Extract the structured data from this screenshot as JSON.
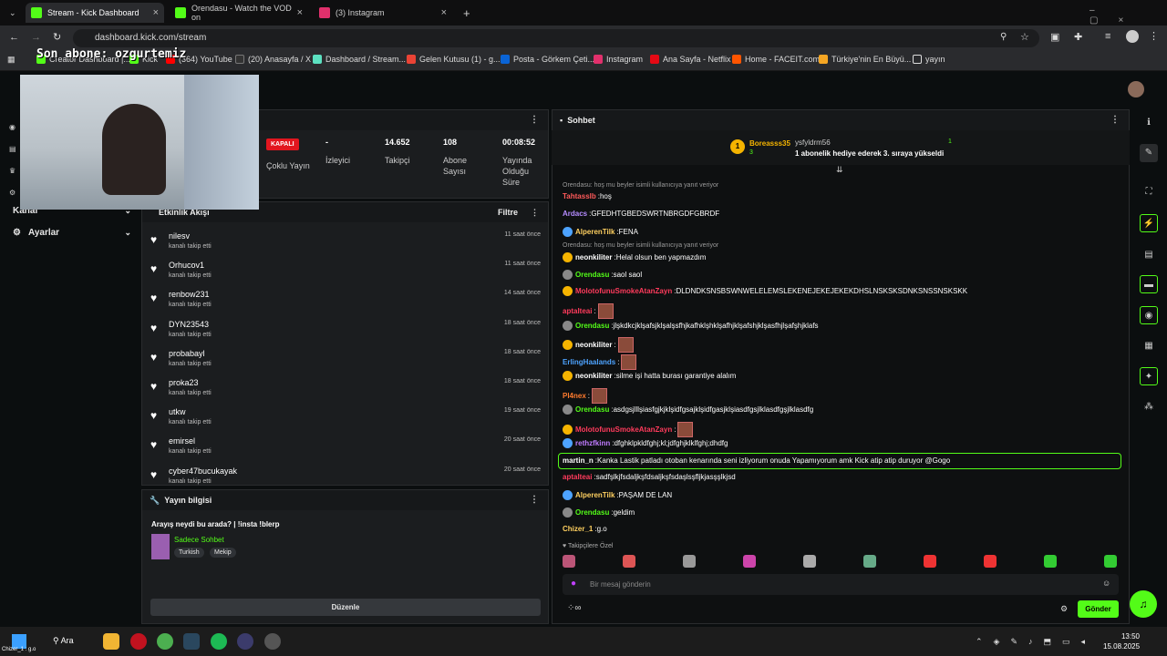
{
  "browser": {
    "tabs": [
      {
        "title": "Stream - Kick Dashboard",
        "active": true
      },
      {
        "title": "Orendasu - Watch the VOD on",
        "active": false
      },
      {
        "title": "(3) Instagram",
        "active": false
      }
    ],
    "url": "dashboard.kick.com/stream",
    "bookmarks": [
      "Creator Dashboard |...",
      "Kick",
      "(364) YouTube",
      "(20) Anasayfa / X",
      "Dashboard / Stream...",
      "Gelen Kutusu (1) - g...",
      "Posta - Görkem Çeti...",
      "Instagram",
      "Ana Sayfa - Netflix",
      "Home - FACEIT.com",
      "Türkiye'nin En Büyü...",
      "yayın"
    ]
  },
  "overlay": {
    "text": "Son abone: ozgurtemiz"
  },
  "sidebar": {
    "items": [
      {
        "label": "Kanal"
      },
      {
        "label": "Ayarlar"
      }
    ]
  },
  "stats": {
    "status": "KAPALI",
    "multi": "Çoklu Yayın",
    "viewers": {
      "value": "-",
      "label": "İzleyici"
    },
    "followers": {
      "value": "14.652",
      "label": "Takipçi"
    },
    "subs": {
      "value": "108",
      "label": "Abone Sayısı"
    },
    "uptime": {
      "value": "00:08:52",
      "label": "Yayında Olduğu Süre"
    }
  },
  "activity": {
    "title": "Etkinlik Akışı",
    "filter": "Filtre",
    "items": [
      {
        "name": "nilesv",
        "sub": "kanalı takip etti",
        "time": "11 saat önce"
      },
      {
        "name": "Orhucov1",
        "sub": "kanalı takip etti",
        "time": "11 saat önce"
      },
      {
        "name": "renbow231",
        "sub": "kanalı takip etti",
        "time": "14 saat önce"
      },
      {
        "name": "DYN23543",
        "sub": "kanalı takip etti",
        "time": "18 saat önce"
      },
      {
        "name": "probabayl",
        "sub": "kanalı takip etti",
        "time": "18 saat önce"
      },
      {
        "name": "proka23",
        "sub": "kanalı takip etti",
        "time": "18 saat önce"
      },
      {
        "name": "utkw",
        "sub": "kanalı takip etti",
        "time": "19 saat önce"
      },
      {
        "name": "emirsel",
        "sub": "kanalı takip etti",
        "time": "20 saat önce"
      },
      {
        "name": "cyber47bucukayak",
        "sub": "kanalı takip etti",
        "time": "20 saat önce"
      }
    ]
  },
  "streaminfo": {
    "title": "Yayın bilgisi",
    "stream_title": "Arayış neydi bu arada? | !insta !blerp",
    "category": "Sadece Sohbet",
    "tags": [
      "Turkish",
      "Mekip"
    ],
    "edit": "Düzenle"
  },
  "chat": {
    "title": "Sohbet",
    "pinned": {
      "user1": "Boreasss35",
      "count1": "3",
      "user2": "ysfyldrm56",
      "count2": "1",
      "msg": "1 abonelik hediye ederek 3. sıraya yükseldi"
    },
    "reply1": "Orendasu: hoş mu beyler isimli kullanıcıya yanıt veriyor",
    "reply2": "Orendasu: hoş mu beyler isimli kullanıcıya yanıt veriyor",
    "lines": [
      {
        "user": "Tahtasslb",
        "text": "hoş",
        "color": "#ff5a5a"
      },
      {
        "user": "Ardacs",
        "text": "GFEDHTGBEDSWRTNBRGDFGBRDF",
        "color": "#b58cff"
      },
      {
        "user": "AlperenTilk",
        "text": "FENA",
        "color": "#ffd060"
      },
      {
        "user": "neonkiliter",
        "text": "Helal olsun ben yapmazdım",
        "color": "#ffffff"
      },
      {
        "user": "Orendasu",
        "text": "saol saol",
        "color": "#53fc18"
      },
      {
        "user": "MolotofunuSmokeAtanZayn",
        "text": "DLDNDKSNSBSWNWELELEMSLEKENEJEKEJEKEKDHSLNSKSKSDNKSNSSNSKSKK",
        "color": "#ff3b5c"
      },
      {
        "user": "aptalteai",
        "text": "",
        "color": "#ff3b5c"
      },
      {
        "user": "Orendasu",
        "text": "jlşkdkcjklşafsjklşalşsfhjkafhklşhklşafhjklşafshjklşasfhjlşafşhjklafs",
        "color": "#53fc18"
      },
      {
        "user": "neonkiliter",
        "text": "",
        "color": "#ffffff"
      },
      {
        "user": "ErlingHaalands",
        "text": "",
        "color": "#4da3ff"
      },
      {
        "user": "neonkiliter",
        "text": "silme işi hatta burası garantiye alalım",
        "color": "#ffffff"
      },
      {
        "user": "Pl4nex",
        "text": "",
        "color": "#ff7b2e"
      },
      {
        "user": "Orendasu",
        "text": "asdgsjlllşiasfgjkjklşidfgsajklşidfgasjklşiasdfgsjlklasdfgşjlklasdfg",
        "color": "#53fc18"
      },
      {
        "user": "MolotofunuSmokeAtanZayn",
        "text": "",
        "color": "#ff3b5c"
      },
      {
        "user": "rethzfkinn",
        "text": "dfghklpkldfghj;kl;jdfghjklklfghj;dhdfg",
        "color": "#c07bff"
      },
      {
        "user": "martin_n",
        "text": "Kanka Lastik patladı otoban kenarında seni izliyorum onuda Yapamıyorum amk Kick atip atip duruyor @Gogo",
        "color": "#ffffff"
      },
      {
        "user": "aptalteai",
        "text": "sadfşlkjfsdaljkşfdsaljkşfsdaşlsşfljkjasşşlkjsd",
        "color": "#ff3b5c"
      },
      {
        "user": "AlperenTilk",
        "text": "PAŞAM DE LAN",
        "color": "#ffd060"
      },
      {
        "user": "Orendasu",
        "text": "geldim",
        "color": "#53fc18"
      },
      {
        "user": "Chizer_1",
        "text": "g.o",
        "color": "#ffd060"
      }
    ],
    "followers_only": "Takipçilere Özel",
    "input_placeholder": "Bir mesaj gönderin",
    "send": "Gönder"
  },
  "taskbar": {
    "search": "Ara",
    "time": "13:50",
    "date": "15.08.2025",
    "overlay_text": "Chizer_1 : g.o"
  }
}
